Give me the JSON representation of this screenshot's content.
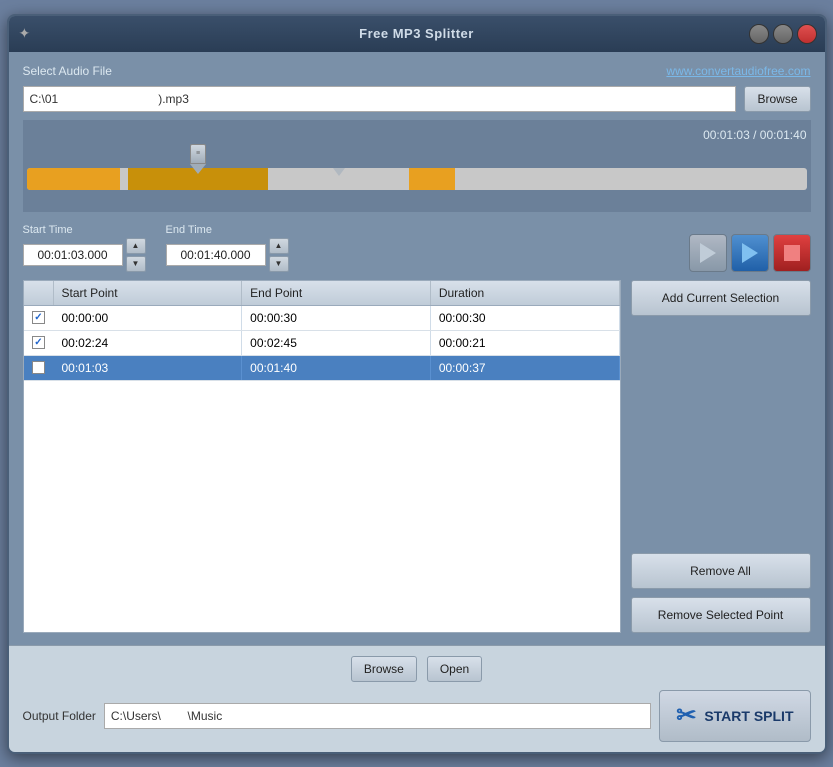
{
  "window": {
    "title": "Free MP3 Splitter",
    "icon": "✦"
  },
  "header": {
    "select_label": "Select Audio File",
    "website_link": "www.convertaudiofree.com",
    "file_path": "C:\\01",
    "file_ext": ".mp3",
    "browse_label": "Browse"
  },
  "timeline": {
    "current_time": "00:01:03",
    "total_time": "00:01:40",
    "time_display": "00:01:03 / 00:01:40"
  },
  "start_time": {
    "label": "Start Time",
    "value": "00:01:03.000"
  },
  "end_time": {
    "label": "End Time",
    "value": "00:01:40.000"
  },
  "table": {
    "headers": [
      "",
      "Start Point",
      "End Point",
      "Duration"
    ],
    "rows": [
      {
        "checked": true,
        "start": "00:00:00",
        "end": "00:00:30",
        "duration": "00:00:30",
        "selected": false
      },
      {
        "checked": true,
        "start": "00:02:24",
        "end": "00:02:45",
        "duration": "00:00:21",
        "selected": false
      },
      {
        "checked": true,
        "start": "00:01:03",
        "end": "00:01:40",
        "duration": "00:00:37",
        "selected": true
      }
    ]
  },
  "buttons": {
    "add_selection": "Add Current Selection",
    "remove_all": "Remove All",
    "remove_selected": "Remove Selected Point",
    "browse": "Browse",
    "open": "Open",
    "start_split": "START SPLIT"
  },
  "output": {
    "label": "Output Folder",
    "path": "C:\\Users\\",
    "path_suffix": "\\Music"
  }
}
